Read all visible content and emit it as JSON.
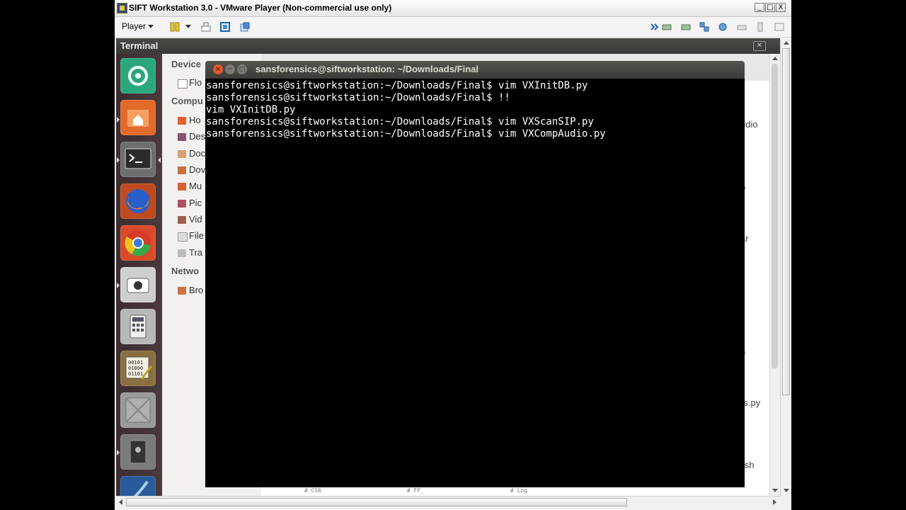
{
  "vmware": {
    "title": "SIFT Workstation 3.0 - VMware Player (Non-commercial use only)",
    "buttons": {
      "minimize": "_",
      "maximize": "□",
      "close": "X"
    },
    "player_menu": "Player"
  },
  "guest": {
    "panel_title": "Terminal",
    "launcher": [
      {
        "name": "dash-home"
      },
      {
        "name": "home-folder"
      },
      {
        "name": "terminal"
      },
      {
        "name": "firefox"
      },
      {
        "name": "chromium"
      },
      {
        "name": "screenshot"
      },
      {
        "name": "calculator"
      },
      {
        "name": "hex-editor"
      },
      {
        "name": "workspace"
      },
      {
        "name": "disk-tool"
      },
      {
        "name": "wireshark"
      }
    ],
    "file_manager": {
      "sidebar": {
        "devices_heading": "Device",
        "devices": [
          "Flo"
        ],
        "computer_heading": "Compu",
        "computer": [
          "Ho",
          "Des",
          "Doc",
          "Dov",
          "Mu",
          "Pic",
          "Vid",
          "File",
          "Tra"
        ],
        "network_heading": "Netwo",
        "network": [
          "Bro"
        ]
      },
      "right_items": [
        "udio",
        "p",
        "ar",
        "h",
        "ics.py",
        "o.sh"
      ],
      "bottom_labels": [
        "# CS6",
        "# FF_",
        "# Log"
      ]
    }
  },
  "terminal": {
    "title": "sansforensics@siftworkstation: ~/Downloads/Final",
    "lines": [
      "sansforensics@siftworkstation:~/Downloads/Final$ vim VXInitDB.py",
      "sansforensics@siftworkstation:~/Downloads/Final$ !!",
      "vim VXInitDB.py",
      "sansforensics@siftworkstation:~/Downloads/Final$ vim VXScanSIP.py",
      "sansforensics@siftworkstation:~/Downloads/Final$ vim VXCompAudio.py"
    ]
  },
  "colors": {
    "terminal_bg": "#000000",
    "terminal_fg": "#ffffff",
    "launcher_bg": "#3c2c30",
    "unity_panel": "#3c3b37",
    "close_orange": "#e05a2b"
  }
}
